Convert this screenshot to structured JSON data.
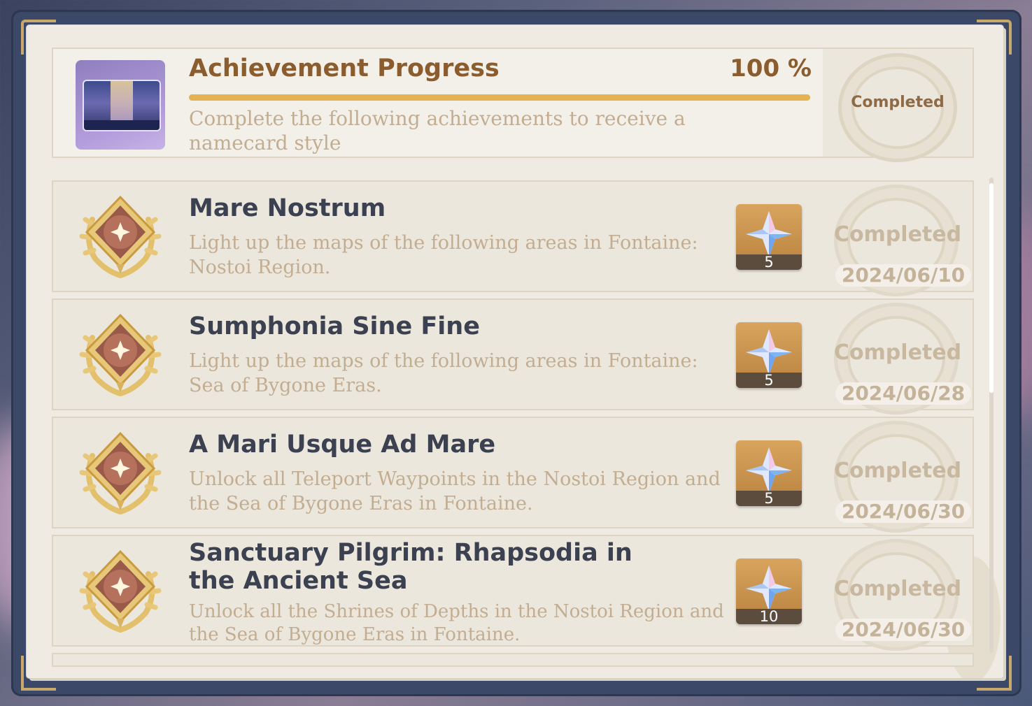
{
  "header": {
    "title": "Achievement Progress",
    "progress_text": "100 %",
    "progress_fraction": 1.0,
    "description": "Complete the following achievements to receive a namecard style",
    "status": "Completed",
    "thumbnail_icon": "namecard-preview-icon"
  },
  "achievements": [
    {
      "title": "Mare Nostrum",
      "description": "Light up the maps of the following areas in Fontaine: Nostoi Region.",
      "reward_icon": "primogem-icon",
      "reward_count": "5",
      "status": "Completed",
      "date": "2024/06/10"
    },
    {
      "title": "Sumphonia Sine Fine",
      "description": "Light up the maps of the following areas in Fontaine: Sea of Bygone Eras.",
      "reward_icon": "primogem-icon",
      "reward_count": "5",
      "status": "Completed",
      "date": "2024/06/28"
    },
    {
      "title": "A Mari Usque Ad Mare",
      "description": "Unlock all Teleport Waypoints in the Nostoi Region and the Sea of Bygone Eras in Fontaine.",
      "reward_icon": "primogem-icon",
      "reward_count": "5",
      "status": "Completed",
      "date": "2024/06/30"
    },
    {
      "title": "Sanctuary Pilgrim: Rhapsodia in the Ancient Sea",
      "description": "Unlock all the Shrines of Depths in the Nostoi Region and the Sea of Bygone Eras in Fontaine.",
      "reward_icon": "primogem-icon",
      "reward_count": "10",
      "status": "Completed",
      "date": "2024/06/30"
    }
  ],
  "colors": {
    "accent_gold": "#e5b250",
    "title_brown": "#8a5c2e",
    "title_dark": "#3b4150",
    "description_tan": "#c3ad91",
    "paper": "#efebe3",
    "frame": "#3b4867"
  }
}
